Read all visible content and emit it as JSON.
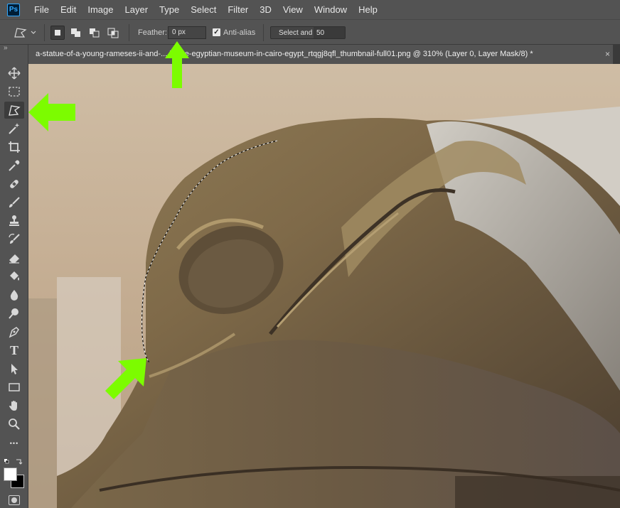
{
  "app": {
    "logo_text": "Ps",
    "accent": "#31a8ff"
  },
  "menu": [
    "File",
    "Edit",
    "Image",
    "Layer",
    "Type",
    "Select",
    "Filter",
    "3D",
    "View",
    "Window",
    "Help"
  ],
  "options": {
    "feather_label": "Feather:",
    "feather_value": "0 px",
    "antialias_label": "Anti-alias",
    "antialias_checked": true,
    "select_and_label": "Select and",
    "select_and_value": "50"
  },
  "document": {
    "tab_title": "a-statue-of-a-young-rameses-ii-and-... in-the-egyptian-museum-in-cairo-egypt_rtqgj8qfl_thumbnail-full01.png @ 310% (Layer 0, Layer Mask/8) *",
    "close_glyph": "×"
  },
  "toolbar": {
    "collapse_glyph": "»",
    "tools": [
      "move-tool",
      "marquee-tool",
      "polygonal-lasso-tool",
      "magic-wand-tool",
      "crop-tool",
      "eyedropper-tool",
      "healing-brush-tool",
      "brush-tool",
      "clone-stamp-tool",
      "history-brush-tool",
      "eraser-tool",
      "paint-bucket-tool",
      "blur-tool",
      "dodge-tool",
      "pen-tool",
      "type-tool",
      "path-selection-tool",
      "rectangle-tool",
      "hand-tool",
      "zoom-tool",
      "more-tools",
      "swap-colors",
      "foreground-background"
    ],
    "type_tool_glyph": "T",
    "more_glyph": "•••",
    "active_tool": "polygonal-lasso-tool"
  },
  "annotations": {
    "arrow_color": "#7cfc00"
  }
}
